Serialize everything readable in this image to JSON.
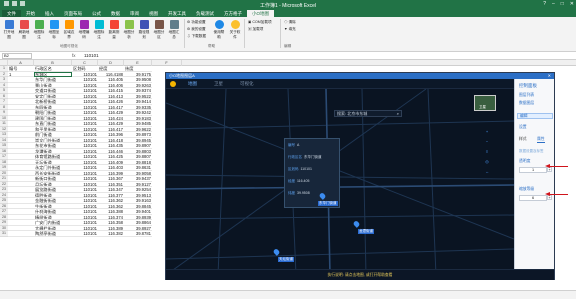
{
  "window": {
    "title": "工作簿1 - Microsoft Excel"
  },
  "tabs": [
    "文件",
    "开始",
    "插入",
    "页面布局",
    "公式",
    "数据",
    "审阅",
    "视图",
    "开发工具",
    "负载测试",
    "方方格子",
    "小O地图"
  ],
  "ribbon": {
    "buttons": [
      "打开地图",
      "刷新地图",
      "地图标注",
      "地图坐标",
      "区域边界",
      "地理编码",
      "地图标注",
      "距离测量",
      "地图分析",
      "路径规划",
      "地图分区",
      "地图汇总"
    ],
    "small_items": [
      "功能设置",
      "我的设置",
      "下载数据",
      "COM加载项",
      "加载项",
      "清除",
      "填充"
    ],
    "help": [
      "使用帮助",
      "关于软件"
    ],
    "group_labels": [
      "地图可视化",
      "帮助",
      "编辑"
    ]
  },
  "formula": {
    "name_box": "B2",
    "fx": "fx",
    "value": "110101"
  },
  "columns": [
    "A",
    "B",
    "C",
    "D",
    "E",
    "F"
  ],
  "sheet": {
    "headers": [
      "编号",
      "行政区名",
      "区划码",
      "经度",
      "纬度"
    ],
    "rows": [
      [
        "1",
        "东城区",
        "110101",
        "116.4188",
        "39.9175"
      ],
      [
        "",
        "东华门街道",
        "110101",
        "116.405",
        "39.9508"
      ],
      [
        "",
        "景山街道",
        "110101",
        "116.406",
        "39.9263"
      ],
      [
        "",
        "交道口街道",
        "110101",
        "116.415",
        "39.9374"
      ],
      [
        "",
        "安定门街道",
        "110101",
        "116.413",
        "39.9522"
      ],
      [
        "",
        "北新桥街道",
        "110101",
        "116.426",
        "39.9414"
      ],
      [
        "",
        "东四街道",
        "110101",
        "116.417",
        "39.9335"
      ],
      [
        "",
        "朝阳门街道",
        "110101",
        "116.429",
        "39.9242"
      ],
      [
        "",
        "建国门街道",
        "110101",
        "116.424",
        "39.9183"
      ],
      [
        "",
        "东直门街道",
        "110101",
        "116.429",
        "39.9485"
      ],
      [
        "",
        "和平里街道",
        "110101",
        "116.417",
        "39.9622"
      ],
      [
        "",
        "前门街道",
        "110101",
        "116.396",
        "39.8973"
      ],
      [
        "",
        "崇文门外街道",
        "110101",
        "116.418",
        "39.8945"
      ],
      [
        "",
        "东花市街道",
        "110101",
        "116.435",
        "39.8907"
      ],
      [
        "",
        "龙潭街道",
        "110101",
        "116.446",
        "39.8803"
      ],
      [
        "",
        "体育馆路街道",
        "110101",
        "116.425",
        "39.8807"
      ],
      [
        "",
        "天坛街道",
        "110101",
        "116.409",
        "39.8818"
      ],
      [
        "",
        "永定门外街道",
        "110101",
        "116.403",
        "39.8631"
      ],
      [
        "",
        "西长安街街道",
        "110101",
        "116.399",
        "39.9058"
      ],
      [
        "",
        "新街口街道",
        "110101",
        "116.367",
        "39.9437"
      ],
      [
        "",
        "月坛街道",
        "110101",
        "116.351",
        "39.9127"
      ],
      [
        "",
        "展览路街道",
        "110101",
        "116.347",
        "39.9254"
      ],
      [
        "",
        "德胜街道",
        "110101",
        "116.377",
        "39.9513"
      ],
      [
        "",
        "金融街街道",
        "110101",
        "116.362",
        "39.9163"
      ],
      [
        "",
        "牛街街道",
        "110101",
        "116.362",
        "39.8845"
      ],
      [
        "",
        "什刹海街道",
        "110101",
        "116.388",
        "39.9401"
      ],
      [
        "",
        "椿树街道",
        "110101",
        "116.374",
        "39.8939"
      ],
      [
        "",
        "广安门内街道",
        "110101",
        "116.358",
        "39.8864"
      ],
      [
        "",
        "大栅栏街道",
        "110101",
        "116.389",
        "39.8927"
      ],
      [
        "",
        "陶然亭街道",
        "110101",
        "116.382",
        "39.8781"
      ]
    ]
  },
  "panel": {
    "title": "小O地图图层A",
    "map_tabs": [
      "地图",
      "卫星",
      "可视化"
    ],
    "search_placeholder": "搜索: 北京市东城",
    "popup": [
      {
        "label": "编号",
        "value": "A"
      },
      {
        "label": "行政区名",
        "value": "东华门街道"
      },
      {
        "label": "区划码",
        "value": "110101"
      },
      {
        "label": "经度",
        "value": "116.405"
      },
      {
        "label": "纬度",
        "value": "39.9508"
      }
    ],
    "pins": [
      "东华门街道",
      "龙潭街道",
      "天坛街道"
    ],
    "bottom_message": "执行说明: 请点击地图, 或打开帮助查看",
    "sidebar": {
      "header": "控制面板",
      "items": [
        "图层列表",
        "数据图层",
        "编辑",
        "设置"
      ],
      "section": "样式",
      "style_tab": "属性",
      "field_label": "数据设置及标签",
      "opacity_label": "透明度",
      "opacity_value": "1",
      "zoom_label": "缩放等级",
      "zoom_value": "6",
      "thumb": "卫星"
    }
  },
  "colors": {
    "excel_green": "#217346",
    "map_bg": "#0a1422",
    "accent_blue": "#2b6fc6",
    "arrow_red": "#d0141c"
  }
}
